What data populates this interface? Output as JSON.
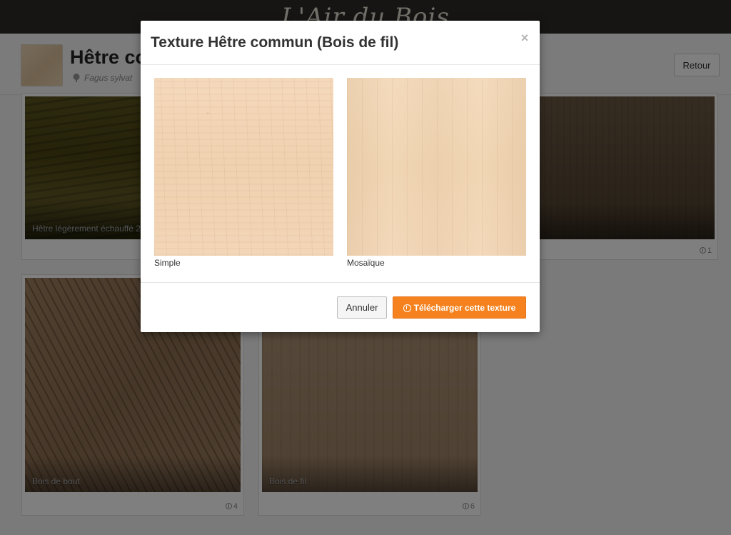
{
  "site": {
    "logo_text": "L'Air du Bois"
  },
  "header": {
    "title": "Hêtre co",
    "subtitle": "Fagus sylvat",
    "back_label": "Retour"
  },
  "cards": [
    {
      "caption": "Hêtre légèrement échauffé 2",
      "downloads": ""
    },
    {
      "caption": "",
      "downloads": "1"
    },
    {
      "caption": "Bois de bout",
      "downloads": "4"
    },
    {
      "caption": "Bois de fil",
      "downloads": "6"
    }
  ],
  "modal": {
    "title": "Texture Hêtre commun (Bois de fil)",
    "close_label": "×",
    "options": [
      {
        "label": "Simple"
      },
      {
        "label": "Mosaïque"
      }
    ],
    "cancel_label": "Annuler",
    "download_label": "Télécharger cette texture"
  },
  "colors": {
    "accent": "#f5821f",
    "topbar": "#2c2a27",
    "overlay": "rgba(0,0,0,0.5)"
  },
  "icons": {
    "close": "close-icon",
    "download": "download-icon",
    "tree": "tree-icon",
    "download_count": "download-count-icon"
  }
}
